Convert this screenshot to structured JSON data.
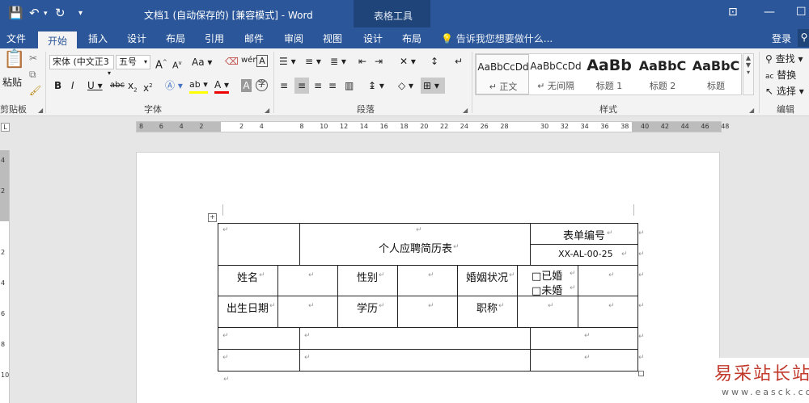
{
  "titlebar": {
    "doc_title": "文档1 (自动保存的) [兼容模式] - Word",
    "table_tools": "表格工具"
  },
  "tabs": {
    "file": "文件",
    "home": "开始",
    "insert": "插入",
    "design": "设计",
    "layout": "布局",
    "references": "引用",
    "mailings": "邮件",
    "review": "审阅",
    "view": "视图",
    "table_design": "设计",
    "table_layout": "布局",
    "tell_me": "告诉我您想要做什么...",
    "login": "登录"
  },
  "ribbon": {
    "paste": "粘贴",
    "clipboard": "剪贴板",
    "font_name": "宋体 (中文正3",
    "font_size": "五号",
    "grow": "A",
    "shrink": "A",
    "case": "Aa",
    "wen": "wén",
    "font_group": "字体",
    "paragraph_group": "段落",
    "styles_group": "样式",
    "editing_group": "编辑",
    "find": "查找",
    "replace": "替换",
    "select": "选择",
    "styles": [
      {
        "preview": "AaBbCcDd",
        "name": "↵ 正文"
      },
      {
        "preview": "AaBbCcDd",
        "name": "↵ 无间隔"
      },
      {
        "preview": "AaBb",
        "name": "标题 1"
      },
      {
        "preview": "AaBbC",
        "name": "标题 2"
      },
      {
        "preview": "AaBbC",
        "name": "标题"
      }
    ]
  },
  "ruler": {
    "h_numbers": [
      "8",
      "6",
      "4",
      "2",
      "",
      "2",
      "4",
      "",
      "8",
      "10",
      "12",
      "14",
      "16",
      "18",
      "20",
      "22",
      "24",
      "26",
      "28",
      "",
      "30",
      "32",
      "34",
      "36",
      "38",
      "40",
      "42",
      "44",
      "46",
      "48"
    ],
    "v_numbers": [
      "4",
      "2",
      "",
      "2",
      "4",
      "6",
      "8",
      "10"
    ]
  },
  "table": {
    "title": "个人应聘简历表",
    "form_no_label": "表单编号",
    "form_no": "XX-AL-00-25",
    "name": "姓名",
    "gender": "性别",
    "marital": "婚姻状况",
    "married": "□已婚",
    "unmarried": "□未婚",
    "birthdate": "出生日期",
    "education": "学历",
    "position": "职称"
  },
  "paragraph_mark": "↵",
  "watermark": {
    "main": "易采站长站",
    "sub": "www.easck.com"
  }
}
